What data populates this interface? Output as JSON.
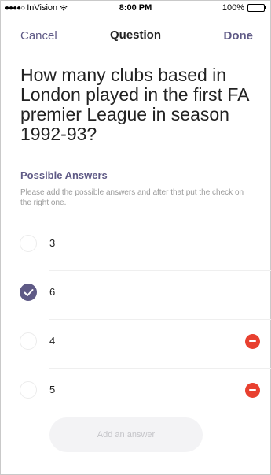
{
  "status_bar": {
    "carrier": "InVision",
    "time": "8:00 PM",
    "battery": "100%",
    "battery_level": 1.0
  },
  "nav": {
    "cancel_label": "Cancel",
    "title": "Question",
    "done_label": "Done"
  },
  "question": {
    "text": "How many clubs based in London played in the first FA premier League in season 1992-93?"
  },
  "answers_section": {
    "title": "Possible Answers",
    "hint": "Please add the possible answers and after that put the check on the right one."
  },
  "answers": [
    {
      "value": "3",
      "checked": false,
      "removable": false
    },
    {
      "value": "6",
      "checked": true,
      "removable": false
    },
    {
      "value": "4",
      "checked": false,
      "removable": true
    },
    {
      "value": "5",
      "checked": false,
      "removable": true
    }
  ],
  "add_button": {
    "label": "Add an answer"
  },
  "colors": {
    "accent": "#5f5a86",
    "remove": "#e8402f",
    "hint_text": "#9a9a9a"
  }
}
